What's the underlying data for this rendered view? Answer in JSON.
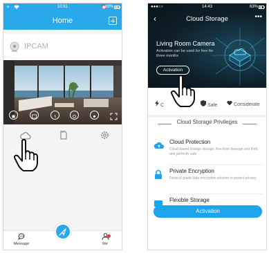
{
  "left": {
    "status": {
      "time": "10:51",
      "battery": "69%"
    },
    "header": {
      "title": "Home"
    },
    "camera": {
      "name": "IPCAM"
    },
    "tabs": {
      "message": "Message",
      "me": "Me"
    },
    "colors": {
      "accent": "#29a9ea",
      "notify": "#e53935"
    }
  },
  "right": {
    "status": {
      "time": "14:43",
      "battery": "63%"
    },
    "header": {
      "title": "Cloud Storage"
    },
    "hero": {
      "title": "Living Room Camera",
      "subtitle": "Activation can be used for free for three months",
      "button_label": "Activation"
    },
    "features": [
      "C",
      "Safe",
      "Considerate"
    ],
    "privileges_title": "Cloud Storage Privileges",
    "items": [
      {
        "title": "Cloud Protection",
        "desc": "Cloud based footage storage, free from damage and theft, and perfectly safe",
        "icon": "cloud-upload-icon"
      },
      {
        "title": "Private Encryption",
        "desc": "Finance grade data encryption solution to protect privacy",
        "icon": "lock-icon"
      },
      {
        "title": "Flexible Storage",
        "desc": "",
        "icon": "storage-icon"
      }
    ],
    "activation_button": "Activation",
    "colors": {
      "accent": "#1ca5ec",
      "hero_bg": "#0e1f29"
    }
  }
}
